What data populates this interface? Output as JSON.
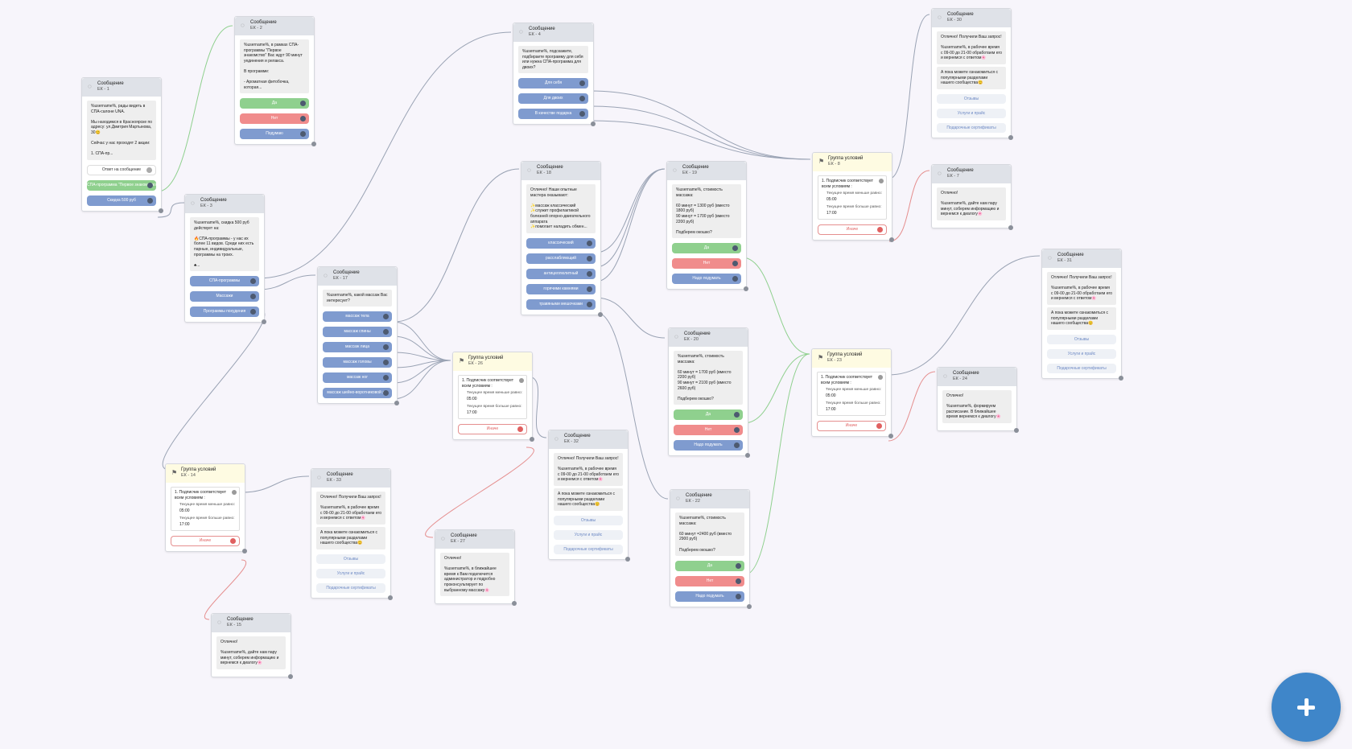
{
  "nodes": [
    {
      "title": "Сообщение",
      "sub": "ЕК - 1",
      "msg": "%username%, рады видеть в СПА-салоне UNA.\n\nМы находимся в Красноярске по адресу: ул.Дмитрия Мартынова, 30😊\n\nСейчас у нас проходят 2 акции:\n\n1. СПА-пр...",
      "buttons": [
        {
          "label": "Ответ на сообщение",
          "style": "white"
        },
        {
          "label": "СПА-программа \"Первое знакомство\"",
          "style": "green"
        },
        {
          "label": "Скидка 500 руб",
          "style": "blue"
        }
      ]
    },
    {
      "title": "Сообщение",
      "sub": "ЕК - 2",
      "msg": "%username%, в рамках СПА-программы \"Первое знакомство\" Вас ждут 90 минут уединения и релакса.\n\nВ программе:\n\n- Ароматная фитобочка, которая...",
      "buttons": [
        {
          "label": "Да",
          "style": "green"
        },
        {
          "label": "Нет",
          "style": "red"
        },
        {
          "label": "Подумаю",
          "style": "blue"
        }
      ]
    },
    {
      "title": "Сообщение",
      "sub": "ЕК - 3",
      "msg": "%username%, скидка 500 руб действует на:\n\n🔥СПА-программы - у нас их более 11 видов. Среди них есть парные, индивидуальные, программы на троих.\n\n♣...",
      "buttons": [
        {
          "label": "СПА-программы",
          "style": "blue"
        },
        {
          "label": "Массажи",
          "style": "blue"
        },
        {
          "label": "Программы похудения",
          "style": "blue"
        }
      ]
    },
    {
      "title": "Сообщение",
      "sub": "ЕК - 4",
      "msg": "%username%, подскажите, подбираете программу для себя или нужна СПА-программа для двоих?",
      "buttons": [
        {
          "label": "Для себя",
          "style": "blue"
        },
        {
          "label": "Для двоих",
          "style": "blue"
        },
        {
          "label": "В качестве подарка",
          "style": "blue"
        }
      ]
    },
    {
      "title": "Сообщение",
      "sub": "ЕК - 17",
      "msg": "%username%, какой массаж Вас интересует?",
      "buttons": [
        {
          "label": "массаж тела",
          "style": "blue"
        },
        {
          "label": "массаж спины",
          "style": "blue"
        },
        {
          "label": "массаж лица",
          "style": "blue"
        },
        {
          "label": "массаж головы",
          "style": "blue"
        },
        {
          "label": "массаж ног",
          "style": "blue"
        },
        {
          "label": "массаж шейно-воротниковой з...",
          "style": "blue"
        }
      ]
    },
    {
      "title": "Сообщение",
      "sub": "ЕК - 18",
      "msg": "Отлично! Наши опытные мастера оказывают:\n\n✨массаж классический\n✨служит профилактикой болезней опорно-двигательного аппарата\n✨помогает наладить обмен...",
      "buttons": [
        {
          "label": "классический",
          "style": "blue"
        },
        {
          "label": "расслабляющий",
          "style": "blue"
        },
        {
          "label": "антицеллюлитный",
          "style": "blue"
        },
        {
          "label": "горячими камнями",
          "style": "blue"
        },
        {
          "label": "травяными мешочками",
          "style": "blue"
        }
      ]
    },
    {
      "title": "Сообщение",
      "sub": "ЕК - 19",
      "msg": "%username%, стоимость массажа:\n\n60 минут = 1300 руб (вместо 1800 руб)\n90 минут = 1700 руб (вместо 2200 руб)\n\nПодберем окошко?",
      "buttons": [
        {
          "label": "Да",
          "style": "green"
        },
        {
          "label": "Нет",
          "style": "red"
        },
        {
          "label": "Надо подумать",
          "style": "blue"
        }
      ]
    },
    {
      "title": "Сообщение",
      "sub": "ЕК - 20",
      "msg": "%username%, стоимость массажа:\n\n60 минут = 1700 руб (вместо 2200 руб)\n90 минут = 2100 руб (вместо 2600 руб)\n\nПодберем окошко?",
      "buttons": [
        {
          "label": "Да",
          "style": "green"
        },
        {
          "label": "Нет",
          "style": "red"
        },
        {
          "label": "Надо подумать",
          "style": "blue"
        }
      ]
    },
    {
      "title": "Сообщение",
      "sub": "ЕК - 22",
      "msg": "%username%, стоимость массажа:\n\n60 минут =2400 руб (вместо 2900 руб)\n\nПодберем окошко?",
      "buttons": [
        {
          "label": "Да",
          "style": "green"
        },
        {
          "label": "Нет",
          "style": "red"
        },
        {
          "label": "Надо подумать",
          "style": "blue"
        }
      ]
    },
    {
      "title": "Сообщение",
      "sub": "ЕК - 30",
      "msg": "Отлично! Получили Ваш запрос!\n\n%username%, в рабочее время с 09-00 до 21-00 обработаем его и вернемся с ответом🌸",
      "msg2": "А пока можете ознакомиться с популярными разделами нашего сообщества😊",
      "buttons": [
        {
          "label": "Отзывы",
          "style": "link"
        },
        {
          "label": "Услуги и прайс",
          "style": "link"
        },
        {
          "label": "Подарочные сертификаты",
          "style": "link"
        }
      ]
    },
    {
      "title": "Сообщение",
      "sub": "ЕК - 7",
      "msg": "Отлично!\n\n%username%, дайте нам пару минут, соберем информацию и вернемся к диалогу🌸",
      "buttons": []
    },
    {
      "title": "Сообщение",
      "sub": "ЕК - 31",
      "msg": "Отлично! Получили Ваш запрос!\n\n%username%, в рабочее время с 09-00 до 21-00 обработаем его и вернемся с ответом🌸",
      "msg2": "А пока можете ознакомиться с популярными разделами нашего сообщества😊",
      "buttons": [
        {
          "label": "Отзывы",
          "style": "link"
        },
        {
          "label": "Услуги и прайс",
          "style": "link"
        },
        {
          "label": "Подарочные сертификаты",
          "style": "link"
        }
      ]
    },
    {
      "title": "Сообщение",
      "sub": "ЕК - 24",
      "msg": "Отлично!\n\n%username%, формируем расписание. В ближайшее время вернемся к диалогу🌸",
      "buttons": []
    },
    {
      "title": "Сообщение",
      "sub": "ЕК - 32",
      "msg": "Отлично! Получили Ваш запрос!\n\n%username%, в рабочее время с 09-00 до 21-00 обработаем его и вернемся с ответом🌸",
      "msg2": "А пока можете ознакомиться с популярными разделами нашего сообщества😊",
      "buttons": [
        {
          "label": "Отзывы",
          "style": "link"
        },
        {
          "label": "Услуги и прайс",
          "style": "link"
        },
        {
          "label": "Подарочные сертификаты",
          "style": "link"
        }
      ]
    },
    {
      "title": "Сообщение",
      "sub": "ЕК - 33",
      "msg": "Отлично! Получили Ваш запрос!\n\n%username%, в рабочее время с 09-00 до 21-00 обработаем его и вернемся с ответом🌸",
      "msg2": "А пока можете ознакомиться с популярными разделами нашего сообщества😊",
      "buttons": [
        {
          "label": "Отзывы",
          "style": "link"
        },
        {
          "label": "Услуги и прайс",
          "style": "link"
        },
        {
          "label": "Подарочные сертификаты",
          "style": "link"
        }
      ]
    },
    {
      "title": "Сообщение",
      "sub": "ЕК - 27",
      "msg": "Отлично!\n\n%username%, в ближайшее время к Вам подключится администратор и подробно проконсультирует по выбранному массажу🌸",
      "buttons": []
    },
    {
      "title": "Сообщение",
      "sub": "ЕК - 15",
      "msg": "Отлично!\n\n%username%, дайте нам пару минут, соберем информацию и вернемся к диалогу🌸",
      "buttons": []
    }
  ],
  "conditions": [
    {
      "title": "Группа условий",
      "sub": "ЕК - 8",
      "cond": "1. Подписчик соответствует всем условиям :",
      "c1": "Текущее время меньше равно:",
      "v1": "05:00",
      "c2": "Текущее время больше равно:",
      "v2": "17:00",
      "else_label": "Иначе"
    },
    {
      "title": "Группа условий",
      "sub": "ЕК - 23",
      "cond": "1. Подписчик соответствует всем условиям :",
      "c1": "Текущее время меньше равно:",
      "v1": "05:00",
      "c2": "Текущее время больше равно:",
      "v2": "17:00",
      "else_label": "Иначе"
    },
    {
      "title": "Группа условий",
      "sub": "ЕК - 26",
      "cond": "1. Подписчик соответствует всем условиям :",
      "c1": "Текущее время меньше равно:",
      "v1": "05:00",
      "c2": "Текущее время больше равно:",
      "v2": "17:00",
      "else_label": "Иначе"
    },
    {
      "title": "Группа условий",
      "sub": "ЕК - 14",
      "cond": "1. Подписчик соответствует всем условиям :",
      "c1": "Текущее время меньше равно:",
      "v1": "05:00",
      "c2": "Текущее время больше равно:",
      "v2": "17:00",
      "else_label": "Иначе"
    }
  ],
  "icons": {
    "message": "chat-bubble-icon",
    "condition": "flag-icon",
    "add": "plus-icon"
  },
  "colors": {
    "background": "#f7f5fb",
    "button_blue": "#7f9bcf",
    "button_green": "#8fd08e",
    "button_red": "#f08c8c",
    "fab": "#3f86c9",
    "edge_grey": "#9aa3b4",
    "edge_green": "#8fd08e",
    "edge_red": "#e58f8f"
  }
}
